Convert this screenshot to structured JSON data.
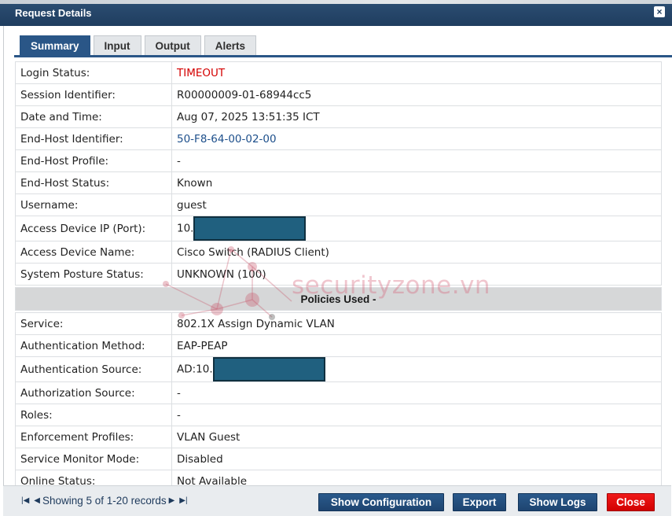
{
  "window": {
    "title": "Request Details",
    "close_glyph": "×"
  },
  "tabs": [
    {
      "label": "Summary",
      "active": true
    },
    {
      "label": "Input",
      "active": false
    },
    {
      "label": "Output",
      "active": false
    },
    {
      "label": "Alerts",
      "active": false
    }
  ],
  "summary": {
    "login_status": {
      "label": "Login Status:",
      "value": "TIMEOUT"
    },
    "session_id": {
      "label": "Session Identifier:",
      "value": "R00000009-01-68944cc5"
    },
    "date_time": {
      "label": "Date and Time:",
      "value": "Aug 07, 2025 13:51:35 ICT"
    },
    "endhost_id": {
      "label": "End-Host Identifier:",
      "value": "50-F8-64-00-02-00"
    },
    "endhost_profile": {
      "label": "End-Host Profile:",
      "value": "-"
    },
    "endhost_status": {
      "label": "End-Host Status:",
      "value": "Known"
    },
    "username": {
      "label": "Username:",
      "value": "guest"
    },
    "access_device_ip": {
      "label": "Access Device IP (Port):",
      "value": "10."
    },
    "access_device_name": {
      "label": "Access Device Name:",
      "value": "Cisco Switch (RADIUS Client)"
    },
    "posture": {
      "label": "System Posture Status:",
      "value": "UNKNOWN (100)"
    }
  },
  "policies": {
    "header": "Policies Used -",
    "service": {
      "label": "Service:",
      "value": "802.1X Assign Dynamic VLAN"
    },
    "auth_method": {
      "label": "Authentication Method:",
      "value": "EAP-PEAP"
    },
    "auth_source": {
      "label": "Authentication Source:",
      "value": "AD:10."
    },
    "authz_source": {
      "label": "Authorization Source:",
      "value": "-"
    },
    "roles": {
      "label": "Roles:",
      "value": "-"
    },
    "enforcement": {
      "label": "Enforcement Profiles:",
      "value": "VLAN Guest"
    },
    "monitor_mode": {
      "label": "Service Monitor Mode:",
      "value": "Disabled"
    },
    "online_status": {
      "label": "Online Status:",
      "value": "Not Available"
    }
  },
  "footer": {
    "pager_text": "Showing 5 of 1-20 records",
    "show_config": "Show Configuration",
    "export": "Export",
    "show_logs": "Show Logs",
    "close": "Close"
  },
  "watermark": {
    "text": "securityzone.vn"
  },
  "colors": {
    "accent": "#2a5687",
    "error": "#d40000",
    "link": "#1d4f8b",
    "close_button": "#e00000"
  }
}
